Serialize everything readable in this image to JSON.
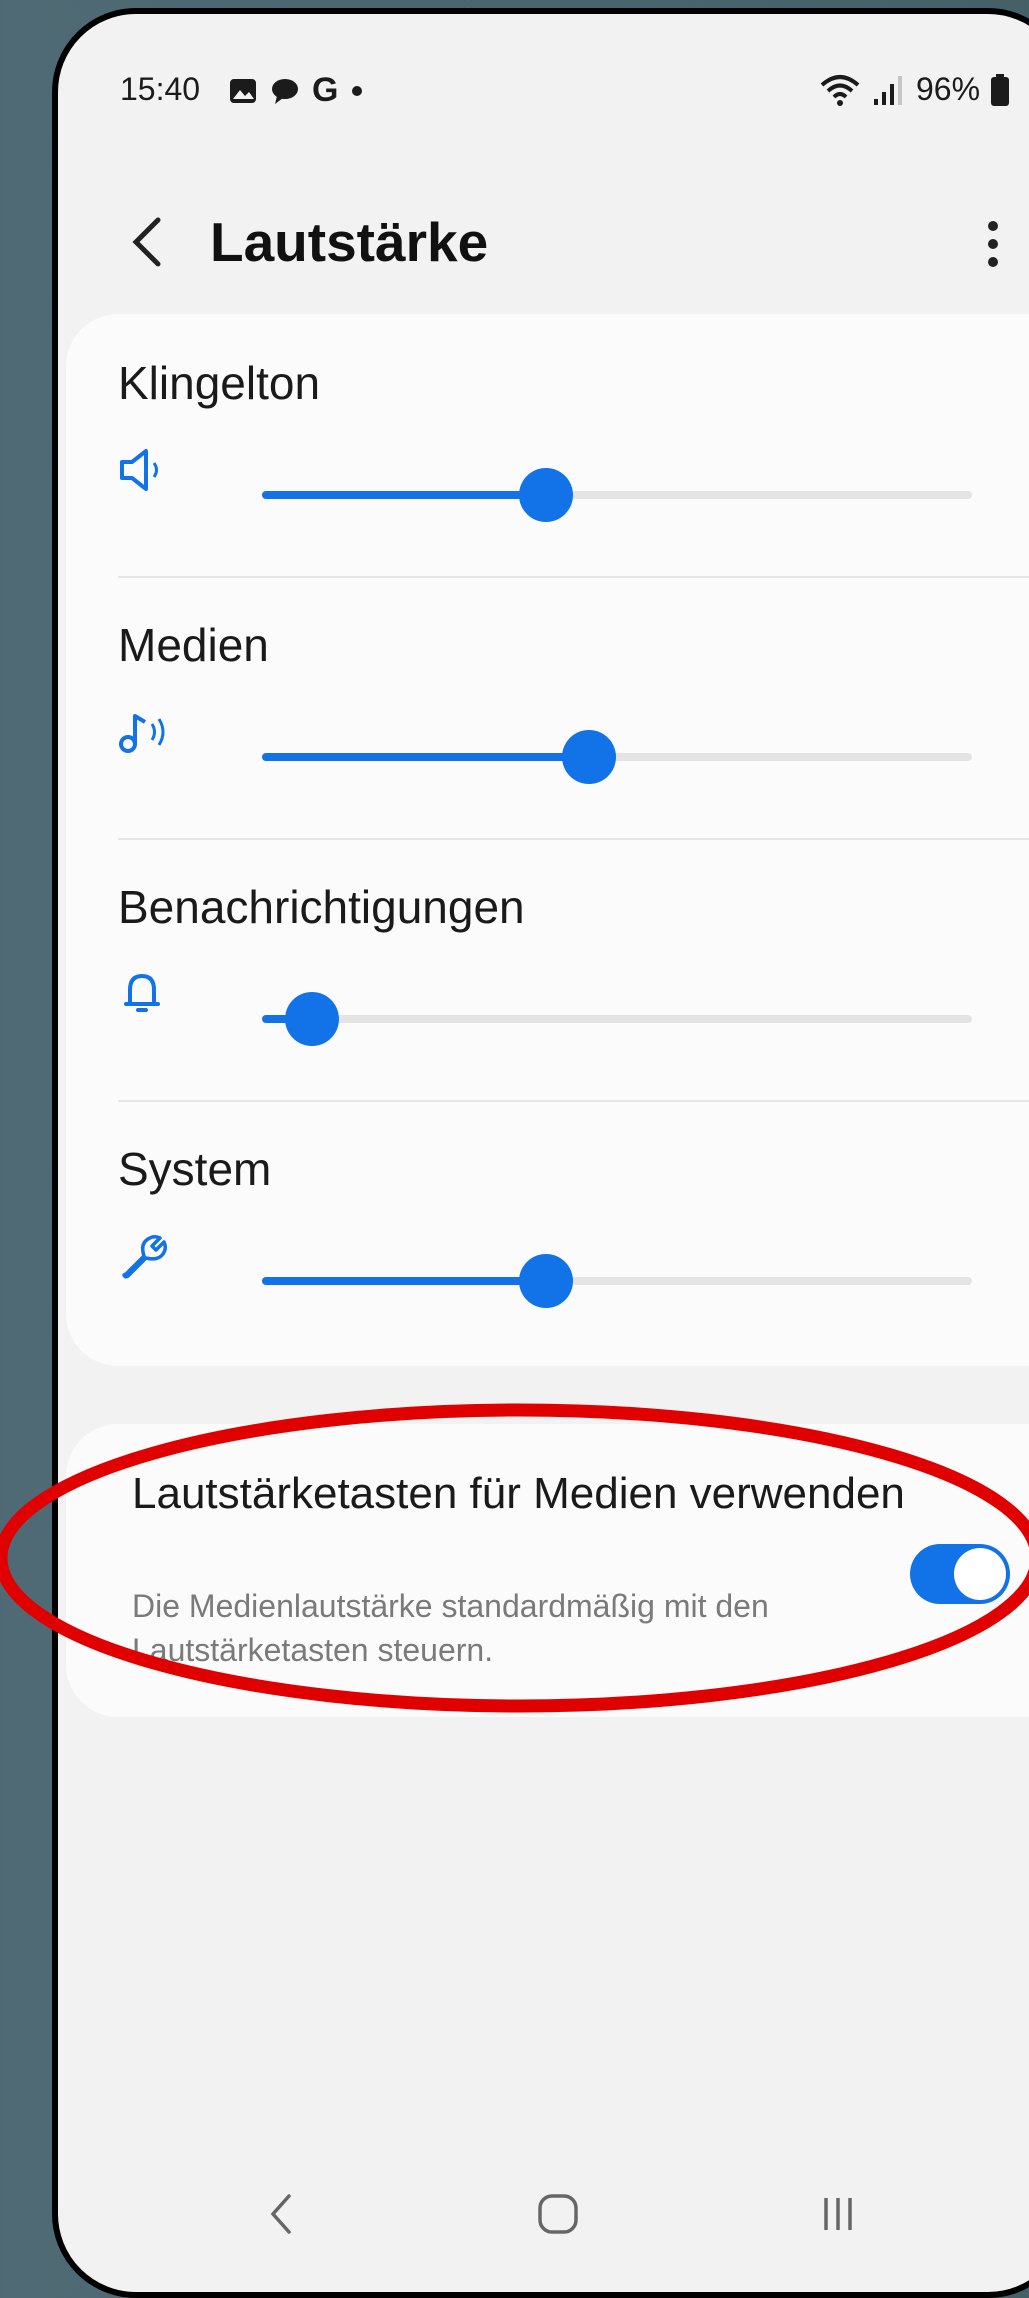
{
  "status_bar": {
    "time": "15:40",
    "notification_icons": [
      "gallery-icon",
      "chat-icon",
      "google-icon",
      "dot-icon"
    ],
    "battery": "96%",
    "right_icons": [
      "wifi-icon",
      "signal-icon",
      "battery-icon"
    ]
  },
  "header": {
    "title": "Lautstärke"
  },
  "volumes": [
    {
      "label": "Klingelton",
      "icon": "speaker-icon",
      "level": 0.4
    },
    {
      "label": "Medien",
      "icon": "music-note-icon",
      "level": 0.46
    },
    {
      "label": "Benachrichtigungen",
      "icon": "bell-icon",
      "level": 0.07
    },
    {
      "label": "System",
      "icon": "wrench-icon",
      "level": 0.4
    }
  ],
  "media_keys": {
    "title": "Lautstärketasten für Medien verwenden",
    "description": "Die Medienlautstärke standardmäßig mit den Lautstärketasten steuern.",
    "enabled": true
  },
  "colors": {
    "accent": "#1273e8",
    "annotation": "#e00000",
    "background": "#f2f2f2",
    "card": "#fbfbfb"
  }
}
